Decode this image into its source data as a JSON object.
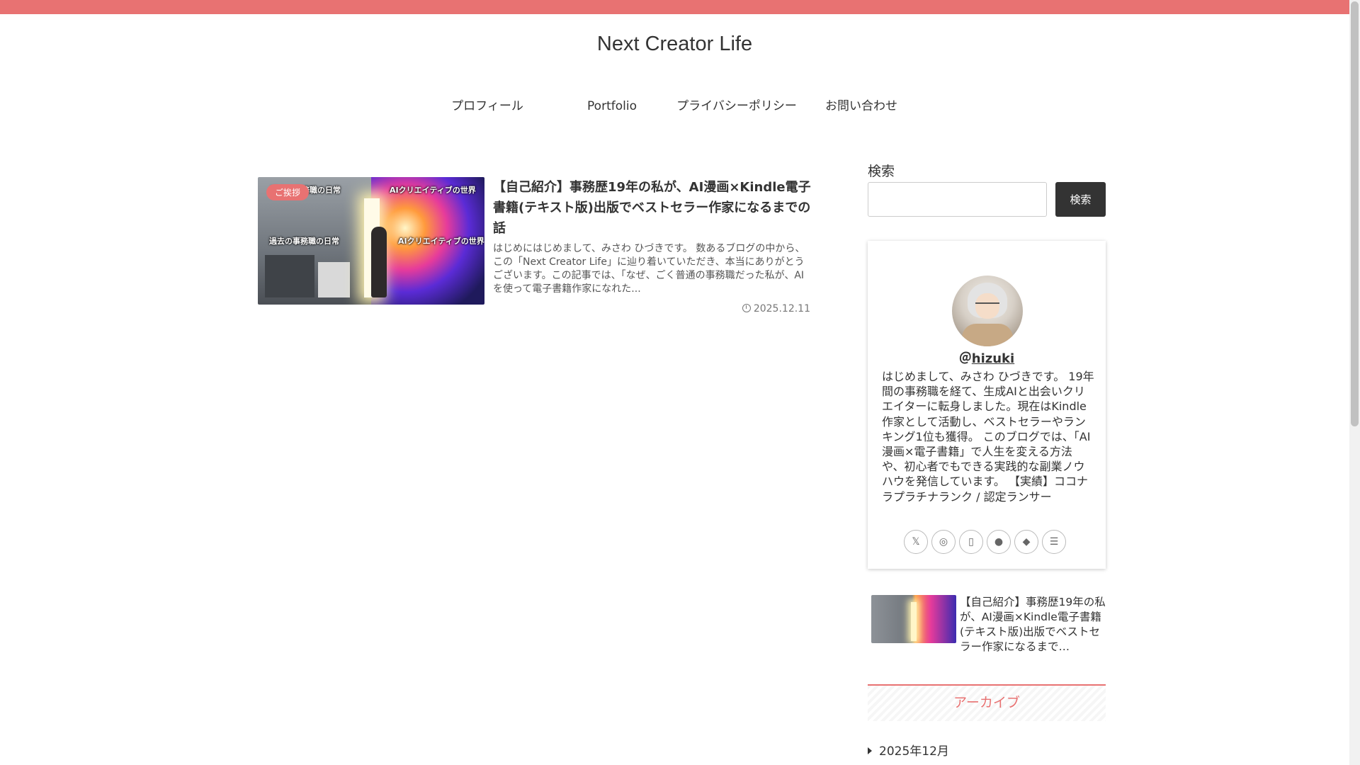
{
  "site": {
    "title": "Next Creator Life"
  },
  "nav": {
    "items": [
      {
        "label": "プロフィール"
      },
      {
        "label": "Portfolio"
      },
      {
        "label": "プライバシーポリシー"
      },
      {
        "label": "お問い合わせ"
      }
    ]
  },
  "article": {
    "category": "ご挨拶",
    "thumb_text_left_top": "過去の事務職の日常",
    "thumb_text_left_mid": "過去の事務職の日常",
    "thumb_text_right_top": "AIクリエイティブの世界",
    "thumb_text_right_mid": "AIクリエイティブの世界",
    "title": "【自己紹介】事務歴19年の私が、AI漫画×Kindle電子書籍(テキスト版)出版でベストセラー作家になるまでの話",
    "excerpt": "はじめにはじめまして、みさわ ひづきです。 数あるブログの中から、この「Next Creator Life」に辿り着いていただき、本当にありがとうございます。この記事では、「なぜ、ごく普通の事務職だった私が、AIを使って電子書籍作家になれた...",
    "date": "2025.12.11"
  },
  "sidebar": {
    "search": {
      "label": "検索",
      "button": "検索",
      "placeholder": ""
    },
    "profile": {
      "at": "＠",
      "username": "hizuki",
      "bio": "はじめまして、みさわ ひづきです。 19年間の事務職を経て、生成AIと出会いクリエイターに転身しました。現在はKindle作家として活動し、ベストセラーやランキング1位も獲得。 このブログでは、「AI漫画×電子書籍」で人生を変える方法や、初心者でもできる実践的な副業ノウハウを発信しています。 【実績】ココナラプラチナランク / 認定ランサー",
      "socials": [
        {
          "icon": "x-icon",
          "glyph": "𝕏"
        },
        {
          "icon": "instagram-icon",
          "glyph": "◎"
        },
        {
          "icon": "book-icon",
          "glyph": "▯"
        },
        {
          "icon": "line-icon",
          "glyph": "●"
        },
        {
          "icon": "feedly-icon",
          "glyph": "◆"
        },
        {
          "icon": "rss-icon",
          "glyph": "☰"
        }
      ]
    },
    "popular": {
      "title": "【自己紹介】事務歴19年の私が、AI漫画×Kindle電子書籍(テキスト版)出版でベストセラー作家になるまで…"
    },
    "archive": {
      "heading": "アーカイブ",
      "items": [
        {
          "label": "2025年12月"
        }
      ]
    }
  },
  "colors": {
    "accent": "#e87272",
    "button": "#333333"
  }
}
